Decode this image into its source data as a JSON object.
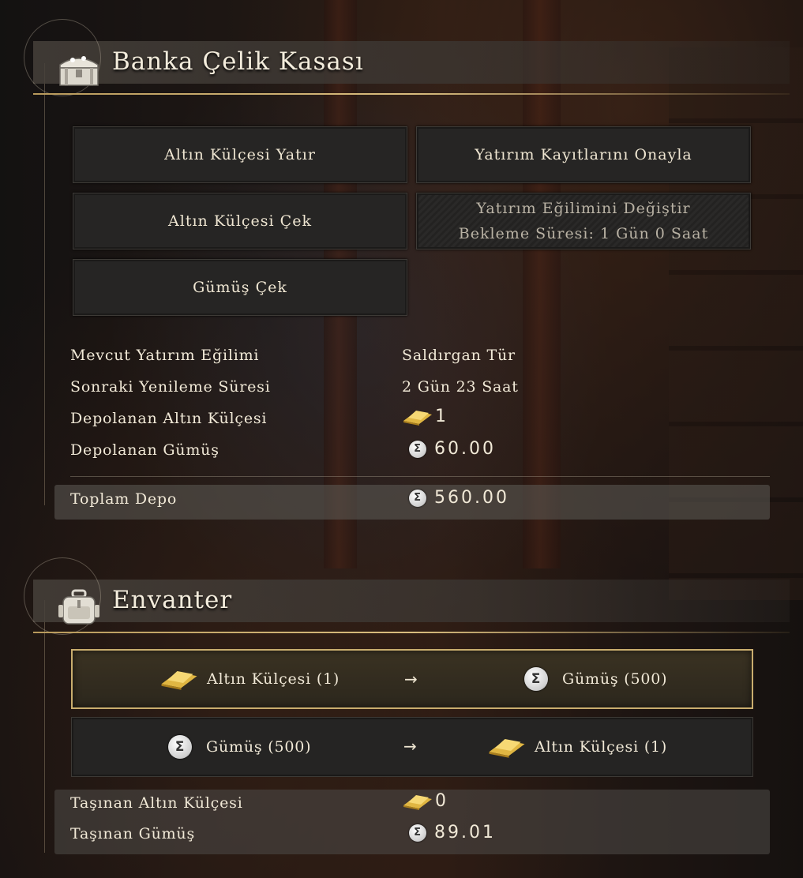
{
  "bank": {
    "title": "Banka Çelik Kasası",
    "buttons": {
      "deposit_gold": "Altın Külçesi Yatır",
      "confirm_records": "Yatırım Kayıtlarını Onayla",
      "withdraw_gold": "Altın Külçesi Çek",
      "change_tendency": "Yatırım Eğilimini Değiştir",
      "cooldown": "Bekleme Süresi: 1 Gün 0 Saat",
      "withdraw_silver": "Gümüş Çek"
    },
    "info": {
      "tendency_label": "Mevcut Yatırım Eğilimi",
      "tendency_value": "Saldırgan Tür",
      "renewal_label": "Sonraki Yenileme Süresi",
      "renewal_value": "2 Gün 23 Saat",
      "stored_gold_label": "Depolanan Altın Külçesi",
      "stored_gold_value": "1",
      "stored_silver_label": "Depolanan Gümüş",
      "stored_silver_value": "60.00",
      "total_label": "Toplam Depo",
      "total_value": "560.00"
    }
  },
  "inventory": {
    "title": "Envanter",
    "exchanges": [
      {
        "from": "Altın Külçesi (1)",
        "arrow": "→",
        "to": "Gümüş (500)"
      },
      {
        "from": "Gümüş (500)",
        "arrow": "→",
        "to": "Altın Külçesi (1)"
      }
    ],
    "carried_gold_label": "Taşınan Altın Külçesi",
    "carried_gold_value": "0",
    "carried_silver_label": "Taşınan Gümüş",
    "carried_silver_value": "89.01"
  },
  "icons": {
    "bank_header": "treasure-chest-icon",
    "inventory_header": "backpack-icon",
    "gold": "gold-bar-icon",
    "silver": "silver-coin-icon"
  },
  "colors": {
    "accent_gold": "#c9ad6e",
    "header_line": "#d9bd7e"
  }
}
